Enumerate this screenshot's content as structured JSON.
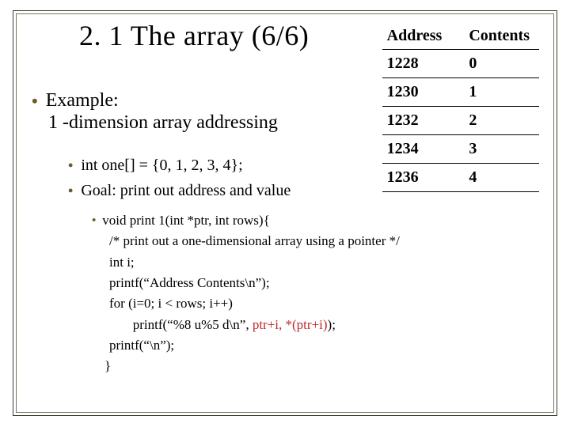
{
  "title": "2. 1 The array (6/6)",
  "example_label": "Example:",
  "example_sub": "1 -dimension array addressing",
  "sub_items": {
    "decl": "int one[] = {0, 1, 2, 3, 4};",
    "goal": "Goal: print out address and value"
  },
  "code": {
    "l1": "void print 1(int *ptr, int rows){",
    "l2": "/* print out a one-dimensional array using a pointer */",
    "l3": "int i;",
    "l4": "printf(“Address Contents\\n”);",
    "l5": "for (i=0; i < rows; i++)",
    "l6a": "       printf(“%8 u%5 d\\n”, ",
    "l6b": "ptr+i, *(ptr+i)",
    "l6c": ");",
    "l7": "printf(“\\n”);",
    "l8": "}"
  },
  "table": {
    "headers": [
      "Address",
      "Contents"
    ],
    "rows": [
      [
        "1228",
        "0"
      ],
      [
        "1230",
        "1"
      ],
      [
        "1232",
        "2"
      ],
      [
        "1234",
        "3"
      ],
      [
        "1236",
        "4"
      ]
    ]
  }
}
